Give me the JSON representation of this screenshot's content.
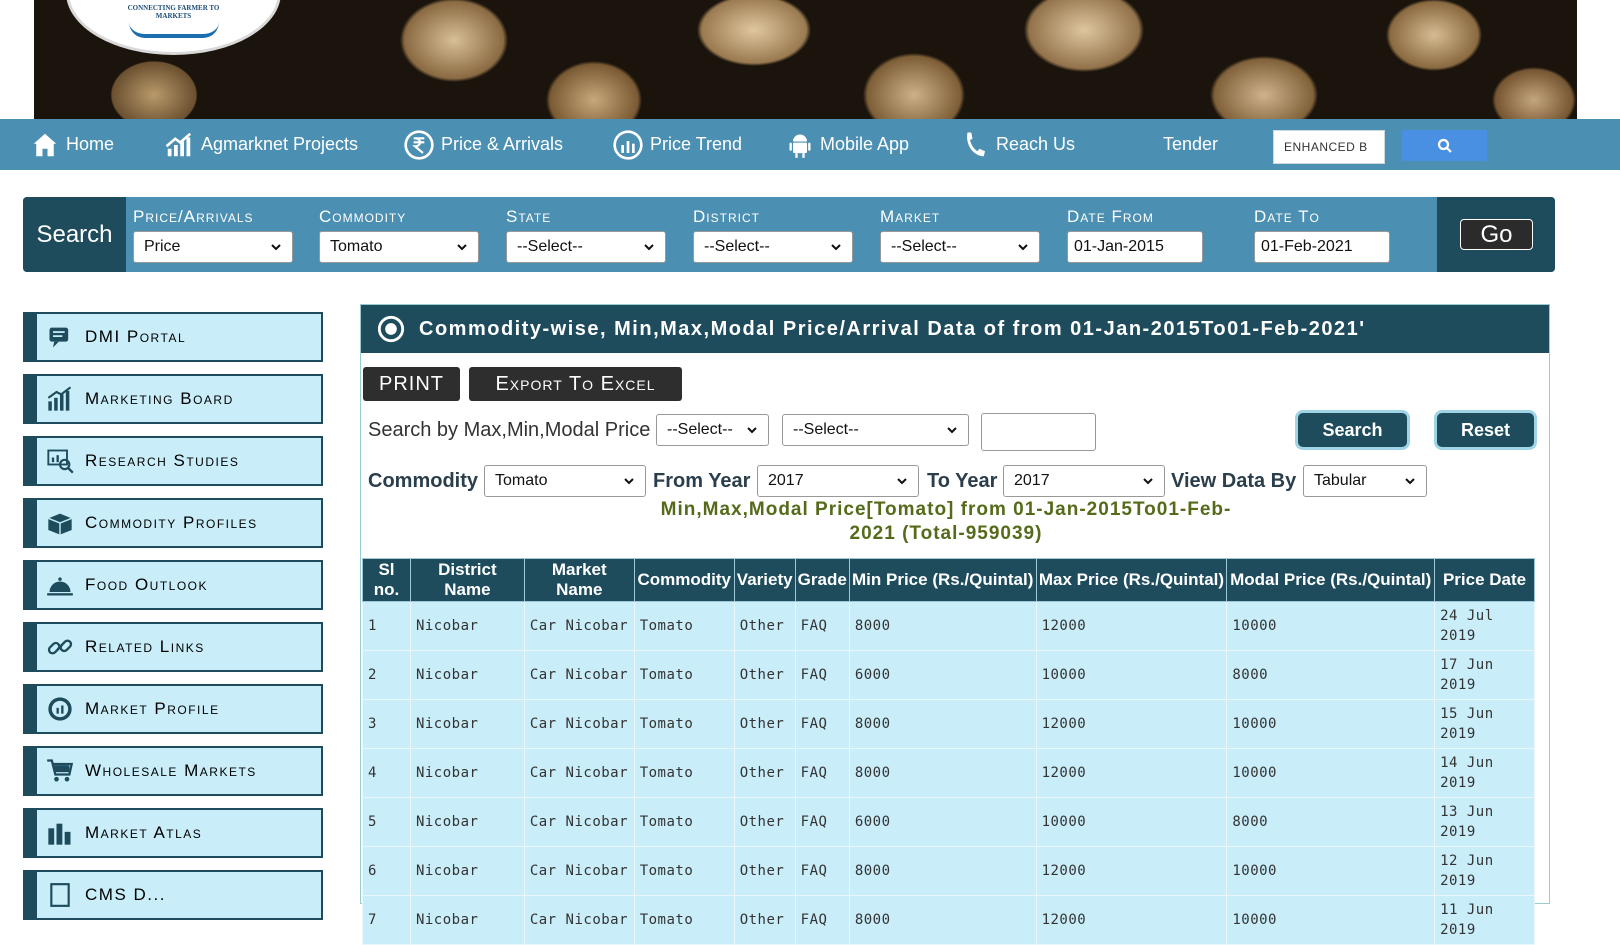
{
  "banner": {
    "logo_text": "CONNECTING FARMER TO MARKETS"
  },
  "nav": {
    "items": [
      {
        "label": "Home",
        "icon": "home-icon"
      },
      {
        "label": "Agmarknet Projects",
        "icon": "chart-icon"
      },
      {
        "label": "Price & Arrivals",
        "icon": "rupee-icon"
      },
      {
        "label": "Price Trend",
        "icon": "gauge-icon"
      },
      {
        "label": "Mobile App",
        "icon": "android-icon"
      },
      {
        "label": "Reach Us",
        "icon": "phone-icon"
      },
      {
        "label": "Tender",
        "icon": ""
      }
    ],
    "search_value": "ENHANCED B",
    "search_button_icon": "search-icon"
  },
  "searchbar": {
    "title": "Search",
    "fields": [
      {
        "label": "Price/Arrivals",
        "value": "Price"
      },
      {
        "label": "Commodity",
        "value": "Tomato"
      },
      {
        "label": "State",
        "value": "--Select--"
      },
      {
        "label": "District",
        "value": "--Select--"
      },
      {
        "label": "Market",
        "value": "--Select--"
      },
      {
        "label": "Date From",
        "value": "01-Jan-2015"
      },
      {
        "label": "Date To",
        "value": "01-Feb-2021"
      }
    ],
    "go_label": "Go"
  },
  "sidebar": {
    "items": [
      {
        "label": "DMI Portal",
        "icon": "chat-icon"
      },
      {
        "label": "Marketing Board",
        "icon": "bar-chart-icon"
      },
      {
        "label": "Research Studies",
        "icon": "research-icon"
      },
      {
        "label": "Commodity Profiles",
        "icon": "box-icon"
      },
      {
        "label": "Food Outlook",
        "icon": "cloche-icon"
      },
      {
        "label": "Related Links",
        "icon": "link-icon"
      },
      {
        "label": "Market Profile",
        "icon": "pie-icon"
      },
      {
        "label": "Wholesale Markets",
        "icon": "cart-icon"
      },
      {
        "label": "Market Atlas",
        "icon": "atlas-icon"
      },
      {
        "label": "CMS D...",
        "icon": "doc-icon"
      }
    ]
  },
  "panel": {
    "title": "Commodity-wise, Min,Max,Modal Price/Arrival Data of from 01-Jan-2015To01-Feb-2021'",
    "print_label": "PRINT",
    "export_label": "Export To Excel",
    "search_by_label": "Search by Max,Min,Modal Price",
    "select1": "--Select--",
    "select2": "--Select--",
    "search_btn": "Search",
    "reset_btn": "Reset",
    "commodity_label": "Commodity",
    "commodity_value": "Tomato",
    "from_year_label": "From Year",
    "from_year_value": "2017",
    "to_year_label": "To Year",
    "to_year_value": "2017",
    "view_by_label": "View Data By",
    "view_by_value": "Tabular",
    "result_title": "Min,Max,Modal Price[Tomato] from 01-Jan-2015To01-Feb-2021 (Total-959039)"
  },
  "table": {
    "headers": [
      "Sl no.",
      "District Name",
      "Market Name",
      "Commodity",
      "Variety",
      "Grade",
      "Min Price (Rs./Quintal)",
      "Max Price (Rs./Quintal)",
      "Modal Price (Rs./Quintal)",
      "Price Date"
    ],
    "rows": [
      [
        "1",
        "Nicobar",
        "Car Nicobar",
        "Tomato",
        "Other",
        "FAQ",
        "8000",
        "12000",
        "10000",
        "24 Jul 2019"
      ],
      [
        "2",
        "Nicobar",
        "Car Nicobar",
        "Tomato",
        "Other",
        "FAQ",
        "6000",
        "10000",
        "8000",
        "17 Jun 2019"
      ],
      [
        "3",
        "Nicobar",
        "Car Nicobar",
        "Tomato",
        "Other",
        "FAQ",
        "8000",
        "12000",
        "10000",
        "15 Jun 2019"
      ],
      [
        "4",
        "Nicobar",
        "Car Nicobar",
        "Tomato",
        "Other",
        "FAQ",
        "8000",
        "12000",
        "10000",
        "14 Jun 2019"
      ],
      [
        "5",
        "Nicobar",
        "Car Nicobar",
        "Tomato",
        "Other",
        "FAQ",
        "6000",
        "10000",
        "8000",
        "13 Jun 2019"
      ],
      [
        "6",
        "Nicobar",
        "Car Nicobar",
        "Tomato",
        "Other",
        "FAQ",
        "8000",
        "12000",
        "10000",
        "12 Jun 2019"
      ],
      [
        "7",
        "Nicobar",
        "Car Nicobar",
        "Tomato",
        "Other",
        "FAQ",
        "8000",
        "12000",
        "10000",
        "11 Jun 2019"
      ]
    ]
  },
  "colors": {
    "nav_bg": "#4b8fb2",
    "dark_teal": "#1e4c5d",
    "light_cell": "#c9eef9",
    "result_title": "#556b1a"
  }
}
